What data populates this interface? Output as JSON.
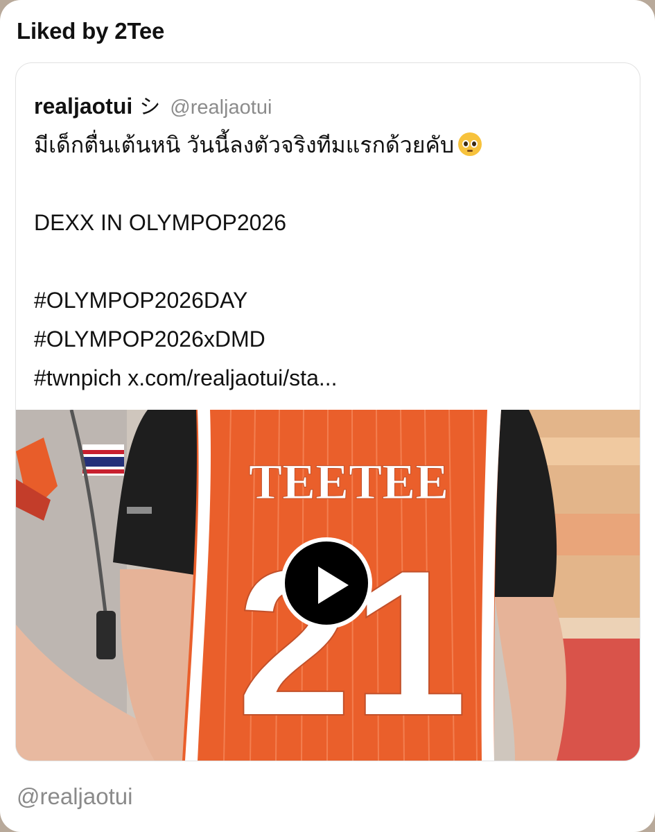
{
  "header": {
    "liked_by": "Liked by 2Tee"
  },
  "post": {
    "author_name": "realjaotui",
    "author_mark": "シ",
    "author_handle": "@realjaotui",
    "text_lines": [
      "มีเด็กตื่นเต้นหนิ วันนี้ลงตัวจริงทีมแรกด้วยคับ",
      "",
      "DEXX IN OLYMPOP2026",
      "",
      "#OLYMPOP2026DAY",
      "#OLYMPOP2026xDMD",
      "#twnpich x.com/realjaotui/sta..."
    ],
    "emoji": "pleading-face",
    "media": {
      "jersey_name": "TEETEE",
      "jersey_number": "21",
      "play_icon": "play-icon"
    }
  },
  "footer": {
    "handle": "@realjaotui"
  },
  "colors": {
    "jersey_orange": "#ea5f2b",
    "handle_gray": "#8b8b8b",
    "text": "#111111"
  }
}
